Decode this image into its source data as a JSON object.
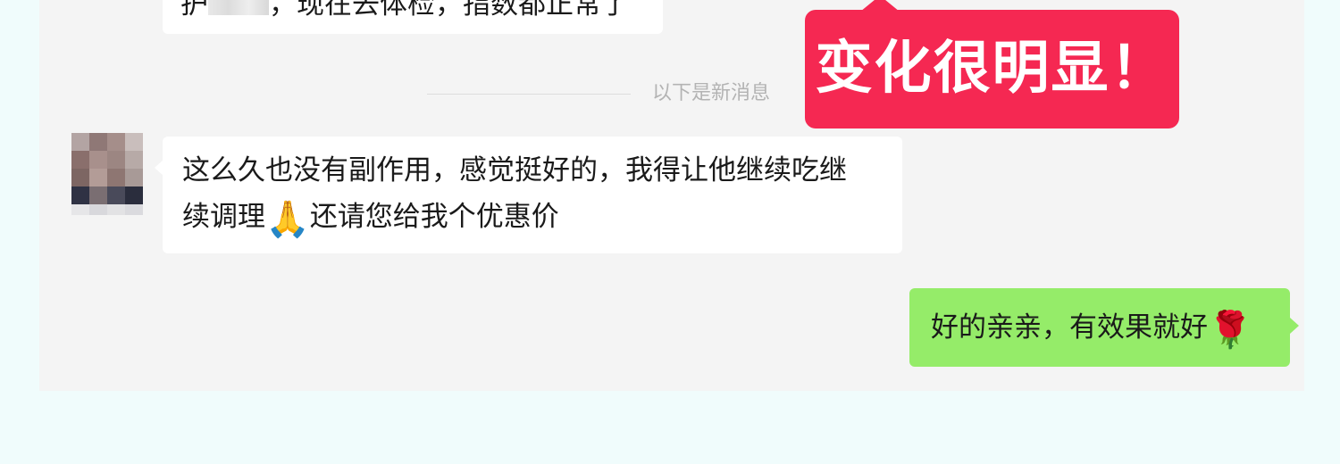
{
  "messages": [
    {
      "direction": "incoming",
      "partial_prefix": "护",
      "partial_text": "，现在去体检，指数都正常了",
      "clipped": true
    },
    {
      "direction": "incoming",
      "text_line1": "这么久也没有副作用，感觉挺好的，我得让他继续吃继",
      "text_line2_start": "续调理",
      "emoji": "🙏",
      "emoji_name": "pray-emoji",
      "text_line2_end": "还请您给我个优惠价"
    },
    {
      "direction": "outgoing",
      "text": "好的亲亲，有效果就好",
      "emoji": "🌹",
      "emoji_name": "rose-emoji"
    }
  ],
  "divider": {
    "label": "以下是新消息"
  },
  "callout": {
    "text": "变化很明显！",
    "color": "#f52852"
  },
  "colors": {
    "outgoing_bubble": "#95ec69",
    "incoming_bubble": "#ffffff",
    "chat_background": "#f4f4f4",
    "page_background": "#f0fcfc"
  }
}
